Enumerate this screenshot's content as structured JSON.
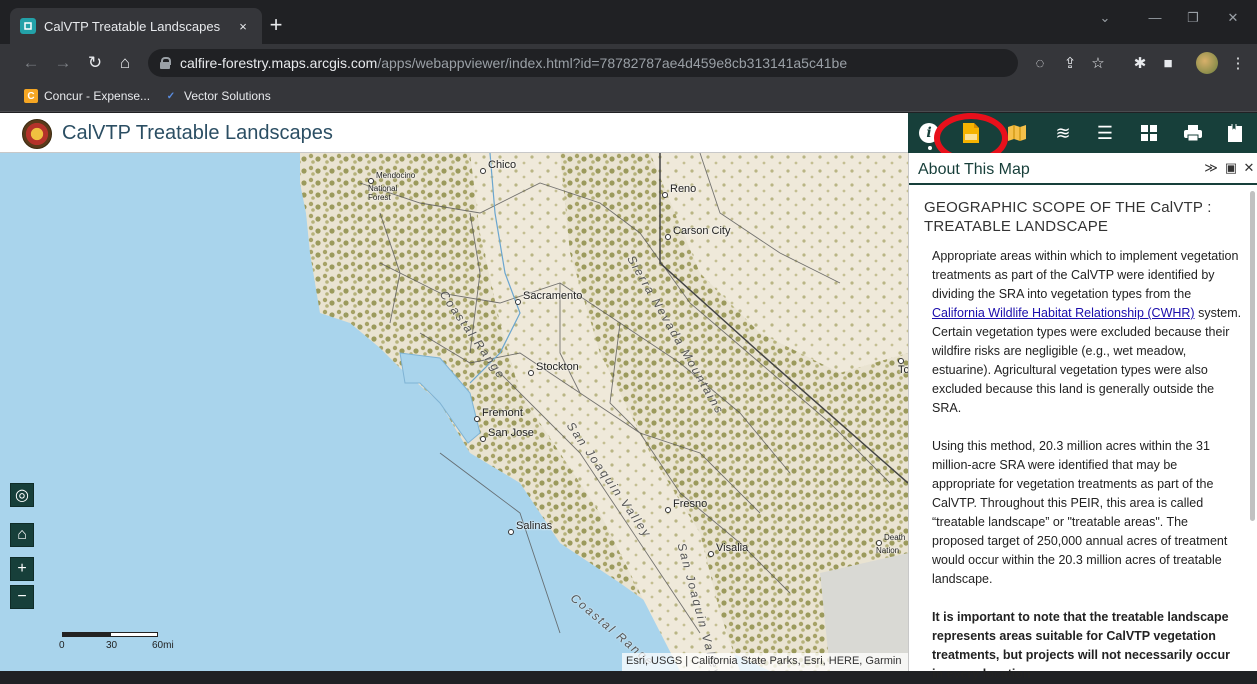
{
  "browser": {
    "tab_title": "CalVTP Treatable Landscapes",
    "tab_close": "×",
    "new_tab": "+",
    "url_host": "calfire-forestry.maps.arcgis.com",
    "url_path": "/apps/webappviewer/index.html?id=78782787ae4d459e8cb313141a5c41be",
    "bookmarks": [
      {
        "label": "Concur - Expense...",
        "icon": "concur-icon",
        "color": "#f5a623"
      },
      {
        "label": "Vector Solutions",
        "icon": "vector-solutions-icon",
        "color": "#5a8de0"
      }
    ]
  },
  "app": {
    "title": "CalVTP Treatable Landscapes",
    "widgets": [
      "info-icon",
      "shapefile-icon",
      "map-icon",
      "layers-icon",
      "legend-icon",
      "basemap-gallery-icon",
      "print-icon",
      "bookmark-icon"
    ],
    "accent": "#173f3a"
  },
  "panel": {
    "title": "About This Map",
    "section_heading": "GEOGRAPHIC SCOPE OF THE CalVTP : TREATABLE LANDSCAPE",
    "p1_before": "Appropriate areas within which to implement vegetation treatments as part of the CalVTP were identified by dividing the SRA into vegetation types from the ",
    "p1_link": "California Wildlife Habitat Relationship (CWHR)",
    "p1_after": " system. Certain vegetation types were excluded because their wildfire risks are negligible (e.g., wet meadow, estuarine). Agricultural vegetation types were also excluded because this land is generally outside the SRA.",
    "p2": "Using this method, 20.3 million acres within the 31 million-acre SRA were identified that may be appropriate for vegetation treatments as part of the CalVTP. Throughout this PEIR, this area is called “treatable landscape” or \"treatable areas\". The proposed target of 250,000 annual acres of treatment would occur within the 20.3 million acres of treatable landscape.",
    "p3": "It is important to note that the treatable landscape represents areas suitable for CalVTP vegetation treatments, but projects will not necessarily occur in every location"
  },
  "map": {
    "cities": [
      "Chico",
      "Reno",
      "Carson City",
      "Sacramento",
      "Stockton",
      "Fremont",
      "San Jose",
      "Fresno",
      "Salinas",
      "Visalia"
    ],
    "partial_labels": [
      "Mendocino National Forest",
      "Death Nation",
      "Tc"
    ],
    "ranges": [
      "Coastal Range",
      "Sierra Nevada Mountains",
      "San Joaquin Valley",
      "Coastal Range",
      "San Joaquin Valley"
    ],
    "scale_labels": [
      "0",
      "30",
      "60mi"
    ],
    "attribution": "Esri, USGS | California State Parks, Esri, HERE, Garmin"
  }
}
